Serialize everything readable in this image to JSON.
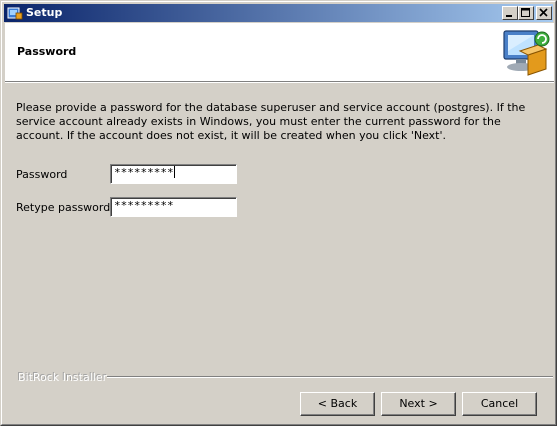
{
  "window": {
    "title": "Setup"
  },
  "header": {
    "title": "Password"
  },
  "description": "Please provide a password for the database superuser and service account (postgres). If the service account already exists in Windows, you must enter the current password for the account. If the account does not exist, it will be created when you click 'Next'.",
  "fields": {
    "password": {
      "label": "Password",
      "value": "*********"
    },
    "retype": {
      "label": "Retype password",
      "value": "*********"
    }
  },
  "footer": {
    "brand": "BitRock Installer"
  },
  "buttons": {
    "back": "< Back",
    "next": "Next >",
    "cancel": "Cancel"
  },
  "colors": {
    "titlebar_start": "#0a246a",
    "titlebar_end": "#a6caf0",
    "face": "#d4d0c8"
  }
}
